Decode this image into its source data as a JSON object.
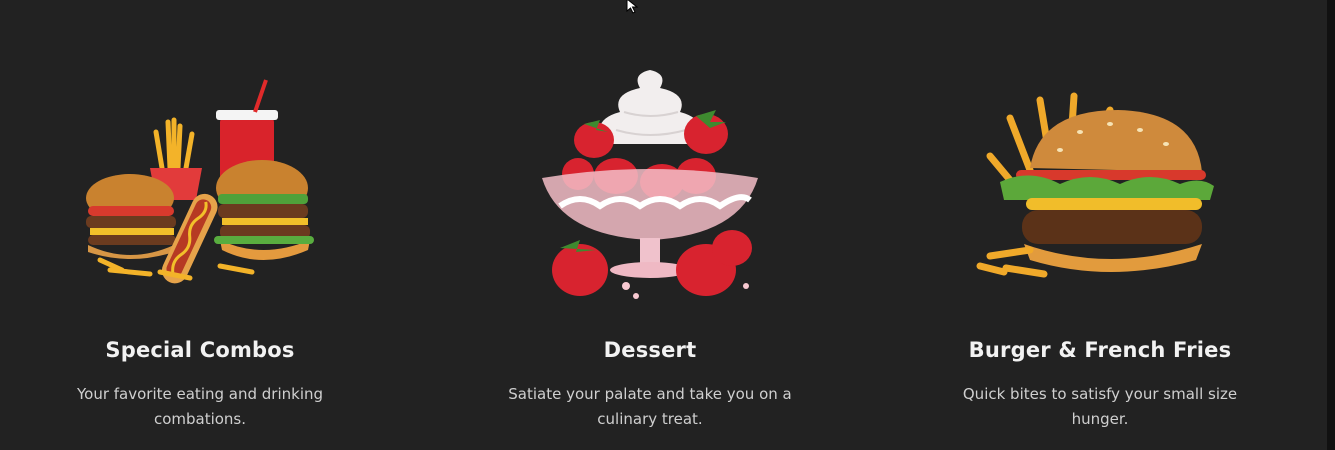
{
  "cards": [
    {
      "title": "Special Combos",
      "description": "Your favorite eating and drinking combations."
    },
    {
      "title": "Dessert",
      "description": "Satiate your palate and take you on a culinary treat."
    },
    {
      "title": "Burger & French Fries",
      "description": "Quick bites to satisfy your small size hunger."
    }
  ],
  "colors": {
    "background": "#222222",
    "title": "#f2f2f2",
    "description": "#cfcfcf"
  },
  "icons": [
    "combo-meal-icon",
    "strawberry-dessert-icon",
    "burger-fries-icon",
    "mouse-cursor-icon"
  ]
}
